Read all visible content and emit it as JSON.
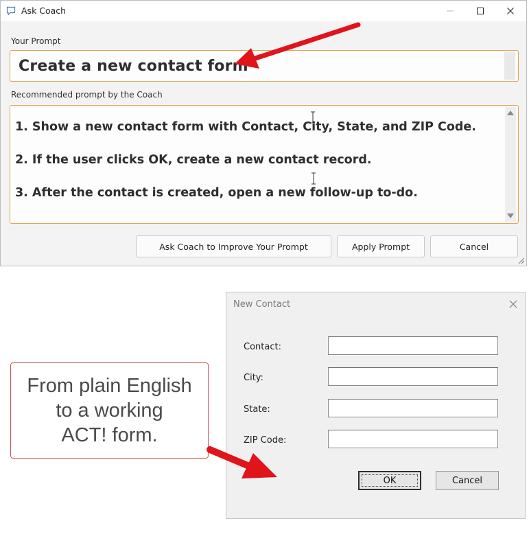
{
  "coach_window": {
    "title": "Ask Coach",
    "your_prompt_label": "Your Prompt",
    "your_prompt_value": "Create a new contact form",
    "recommended_label": "Recommended prompt by the Coach",
    "recommended_lines": [
      "1. Show a new contact form with Contact, City, State, and ZIP Code.",
      "2. If the user clicks OK, create a new contact record.",
      "3. After the contact is created, open a new follow-up to-do."
    ],
    "buttons": {
      "improve": "Ask Coach to Improve Your Prompt",
      "apply": "Apply Prompt",
      "cancel": "Cancel"
    }
  },
  "contact_dialog": {
    "title": "New Contact",
    "fields": [
      {
        "label": "Contact:",
        "value": ""
      },
      {
        "label": "City:",
        "value": ""
      },
      {
        "label": "State:",
        "value": ""
      },
      {
        "label": "ZIP Code:",
        "value": ""
      }
    ],
    "ok_label": "OK",
    "cancel_label": "Cancel"
  },
  "callout": {
    "text": "From plain English\nto a working\nACT! form."
  },
  "colors": {
    "accent_border": "#e0a552",
    "arrow_red": "#e0141b",
    "callout_border": "#d9534f"
  },
  "icons": [
    "chat-bubble-icon",
    "minimize-icon",
    "maximize-icon",
    "close-icon",
    "text-cursor-icon",
    "resize-grip-icon",
    "red-arrow-icon"
  ]
}
